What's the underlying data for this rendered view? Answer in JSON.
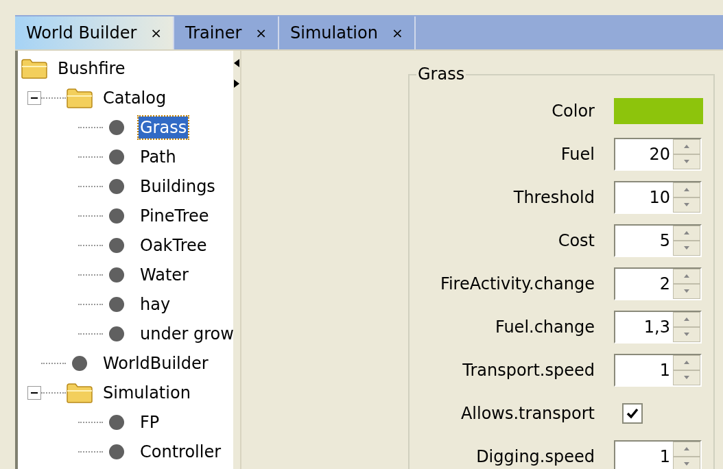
{
  "tabs": [
    {
      "label": "World Builder",
      "close": "×",
      "selected": true
    },
    {
      "label": "Trainer",
      "close": "×",
      "selected": false
    },
    {
      "label": "Simulation",
      "close": "×",
      "selected": false
    }
  ],
  "tree": {
    "label": "Bushfire",
    "kind": "folder",
    "selected": false,
    "children": [
      {
        "label": "Catalog",
        "kind": "folder",
        "expanded": true,
        "selected": false,
        "children": [
          {
            "label": "Grass",
            "kind": "leaf",
            "selected": true
          },
          {
            "label": "Path",
            "kind": "leaf",
            "selected": false
          },
          {
            "label": "Buildings",
            "kind": "leaf",
            "selected": false
          },
          {
            "label": "PineTree",
            "kind": "leaf",
            "selected": false
          },
          {
            "label": "OakTree",
            "kind": "leaf",
            "selected": false
          },
          {
            "label": "Water",
            "kind": "leaf",
            "selected": false
          },
          {
            "label": "hay",
            "kind": "leaf",
            "selected": false
          },
          {
            "label": "under grow",
            "kind": "leaf",
            "selected": false
          }
        ]
      },
      {
        "label": "WorldBuilder",
        "kind": "leaf",
        "selected": false
      },
      {
        "label": "Simulation",
        "kind": "folder",
        "expanded": true,
        "selected": false,
        "children": [
          {
            "label": "FP",
            "kind": "leaf",
            "selected": false
          },
          {
            "label": "Controller",
            "kind": "leaf",
            "selected": false
          }
        ]
      }
    ]
  },
  "group": {
    "title": "Grass",
    "fields": [
      {
        "label": "Color",
        "kind": "color",
        "color": "#8dc40c"
      },
      {
        "label": "Fuel",
        "kind": "spinner",
        "value": "20"
      },
      {
        "label": "Threshold",
        "kind": "spinner",
        "value": "10"
      },
      {
        "label": "Cost",
        "kind": "spinner",
        "value": "5"
      },
      {
        "label": "FireActivity.change",
        "kind": "spinner",
        "value": "2"
      },
      {
        "label": "Fuel.change",
        "kind": "spinner",
        "value": "1,3"
      },
      {
        "label": "Transport.speed",
        "kind": "spinner",
        "value": "1"
      },
      {
        "label": "Allows.transport",
        "kind": "checkbox",
        "checked": true
      },
      {
        "label": "Digging.speed",
        "kind": "spinner",
        "value": "1"
      }
    ]
  }
}
